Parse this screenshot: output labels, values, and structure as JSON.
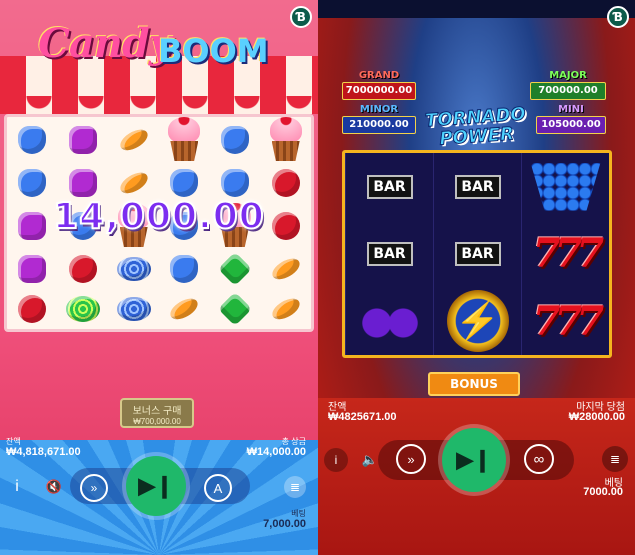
{
  "left_game": {
    "name_line1": "Candy",
    "name_line2": "BOOM",
    "win_amount": "14,000.00",
    "bonus_buy": {
      "label": "보너스 구매",
      "price": "₩700,000.00"
    },
    "balance_label": "잔액",
    "balance_value": "₩4,818,671.00",
    "total_win_label": "총 상금",
    "total_win_value": "₩14,000.00",
    "bet_label": "베팅",
    "bet_value": "7,000.00",
    "grid": [
      [
        "blue",
        "purple",
        "orange",
        "cup",
        "blue",
        "cup"
      ],
      [
        "blue",
        "purple",
        "orange",
        "blue",
        "blue",
        "red"
      ],
      [
        "purple",
        "blue",
        "cup",
        "blue",
        "cup",
        "red"
      ],
      [
        "purple",
        "red",
        "disc",
        "blue",
        "green",
        "orange"
      ],
      [
        "red",
        "wave",
        "disc",
        "orange",
        "green",
        "orange"
      ]
    ],
    "icons": {
      "info": "i",
      "mute": "🔇",
      "auto": "A",
      "stack": "≣",
      "play": "▶❙"
    }
  },
  "right_game": {
    "title_line1": "TORNADO",
    "title_line2": "POWER",
    "jackpots": {
      "grand": {
        "label": "GRAND",
        "value": "7000000.00"
      },
      "major": {
        "label": "MAJOR",
        "value": "700000.00"
      },
      "minor": {
        "label": "MINOR",
        "value": "210000.00"
      },
      "mini": {
        "label": "MINI",
        "value": "105000.00"
      }
    },
    "reel_bar_label": "BAR",
    "bonus_label": "BONUS",
    "balance_label": "잔액",
    "balance_value": "₩4825671.00",
    "last_win_label": "마지막 당첨",
    "last_win_value": "₩28000.00",
    "bet_label": "베팅",
    "bet_value": "7000.00",
    "icons": {
      "info": "i",
      "sound": "🔈",
      "play": "▶❙",
      "loop": "∞",
      "stack": "≣"
    }
  },
  "colors": {
    "left_bg": "#ef4f7a",
    "right_bg": "#c61e14",
    "play_button": "#1fb86a",
    "grand": "#c0141a",
    "major": "#1f7f2a",
    "minor": "#1a3aa0",
    "mini": "#6a1fb0",
    "badge": "#0c5a4a"
  }
}
